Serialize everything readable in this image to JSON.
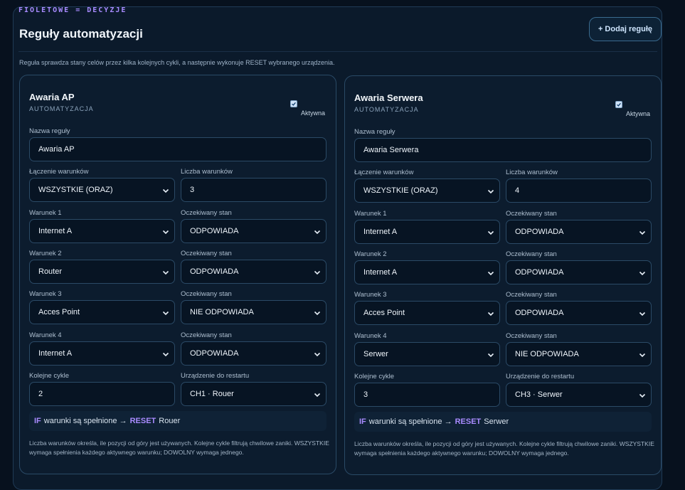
{
  "header": {
    "tag": "FIOLETOWE = DECYZJE",
    "title": "Reguły automatyzacji",
    "add_button": "+ Dodaj regułę",
    "description": "Reguła sprawdza stany celów przez kilka kolejnych cykli, a następnie wykonuje RESET wybranego urządzenia."
  },
  "labels": {
    "subtitle": "AUTOMATYZACJA",
    "active": "Aktywna",
    "rule_name": "Nazwa reguły",
    "combine": "Łączenie warunków",
    "count": "Liczba warunków",
    "expected": "Oczekiwany stan",
    "cycles": "Kolejne cykle",
    "device": "Urządzenie do restartu",
    "if_kw": "IF",
    "if_text": "warunki są spełnione →",
    "reset_kw": "RESET",
    "note": "Liczba warunków określa, ile pozycji od góry jest używanych. Kolejne cykle filtrują chwilowe zaniki. WSZYSTKIE wymaga spełnienia każdego aktywnego warunku; DOWOLNY wymaga jednego."
  },
  "rules": [
    {
      "title": "Awaria AP",
      "active": true,
      "name": "Awaria AP",
      "combine": "WSZYSTKIE (ORAZ)",
      "count": "3",
      "conditions": [
        {
          "label": "Warunek 1",
          "target": "Internet A",
          "state": "ODPOWIADA"
        },
        {
          "label": "Warunek 2",
          "target": "Router",
          "state": "ODPOWIADA"
        },
        {
          "label": "Warunek 3",
          "target": "Acces Point",
          "state": "NIE ODPOWIADA"
        },
        {
          "label": "Warunek 4",
          "target": "Internet A",
          "state": "ODPOWIADA"
        }
      ],
      "cycles": "2",
      "device": "CH1 · Rouer",
      "reset_target": "Rouer"
    },
    {
      "title": "Awaria Serwera",
      "active": true,
      "name": "Awaria Serwera",
      "combine": "WSZYSTKIE (ORAZ)",
      "count": "4",
      "conditions": [
        {
          "label": "Warunek 1",
          "target": "Internet A",
          "state": "ODPOWIADA"
        },
        {
          "label": "Warunek 2",
          "target": "Internet A",
          "state": "ODPOWIADA"
        },
        {
          "label": "Warunek 3",
          "target": "Acces Point",
          "state": "ODPOWIADA"
        },
        {
          "label": "Warunek 4",
          "target": "Serwer",
          "state": "NIE ODPOWIADA"
        }
      ],
      "cycles": "3",
      "device": "CH3 · Serwer",
      "reset_target": "Serwer"
    }
  ]
}
